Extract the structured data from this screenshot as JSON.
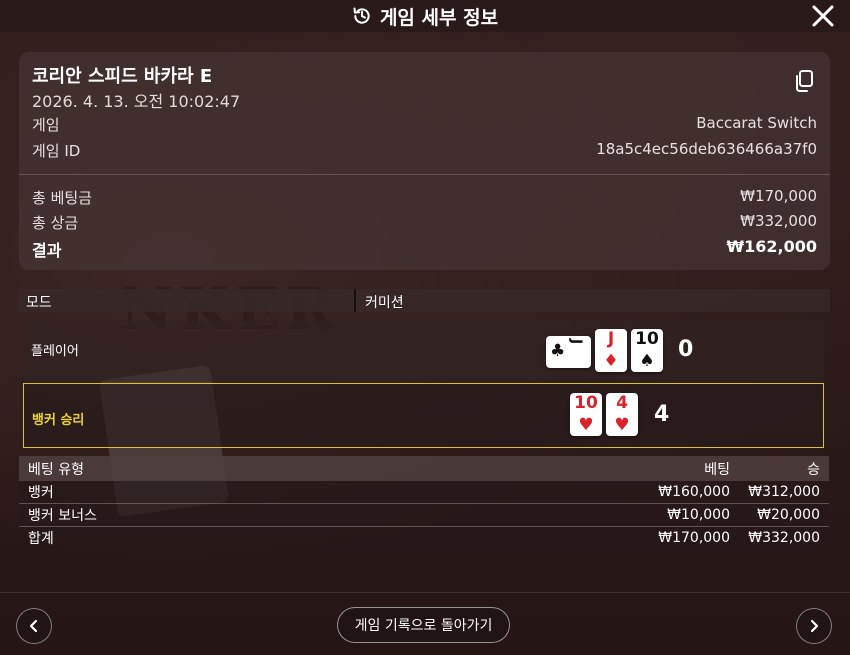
{
  "header": {
    "title": "게임 세부 정보",
    "history_icon": "history-icon",
    "close_icon": "close-icon"
  },
  "summary": {
    "room_name": "코리안 스피드 바카라 E",
    "datetime": "2026. 4. 13. 오전 10:02:47",
    "game_label": "게임",
    "game_value": "Baccarat Switch",
    "game_id_label": "게임 ID",
    "game_id_value": "18a5c4ec56deb636466a37f0",
    "total_bet_label": "총 베팅금",
    "total_bet_value": "₩170,000",
    "total_win_label": "총 상금",
    "total_win_value": "₩332,000",
    "result_label": "결과",
    "result_value": "₩162,000"
  },
  "mode": {
    "label": "모드",
    "value": "커미션"
  },
  "hands": {
    "player": {
      "label": "플레이어",
      "score": "0",
      "cards": [
        {
          "rank": "J",
          "suit": "♣",
          "color": "black",
          "orientation": "sideways"
        },
        {
          "rank": "J",
          "suit": "♦",
          "color": "red"
        },
        {
          "rank": "10",
          "suit": "♠",
          "color": "black"
        }
      ]
    },
    "banker": {
      "label": "뱅커 승리",
      "score": "4",
      "cards": [
        {
          "rank": "10",
          "suit": "♥",
          "color": "red"
        },
        {
          "rank": "4",
          "suit": "♥",
          "color": "red"
        }
      ]
    }
  },
  "bets": {
    "headers": {
      "type": "베팅 유형",
      "bet": "베팅",
      "win": "승"
    },
    "rows": [
      {
        "type": "뱅커",
        "bet": "₩160,000",
        "win": "₩312,000"
      },
      {
        "type": "뱅커 보너스",
        "bet": "₩10,000",
        "win": "₩20,000"
      }
    ],
    "total": {
      "type": "합계",
      "bet": "₩170,000",
      "win": "₩332,000"
    }
  },
  "footer": {
    "back_label": "게임 기록으로 돌아가기",
    "prev_icon": "chevron-left-icon",
    "next_icon": "chevron-right-icon"
  },
  "colors": {
    "highlight_border": "#d8c433",
    "winner_label": "#e8d23a",
    "card_red": "#d8232a"
  }
}
